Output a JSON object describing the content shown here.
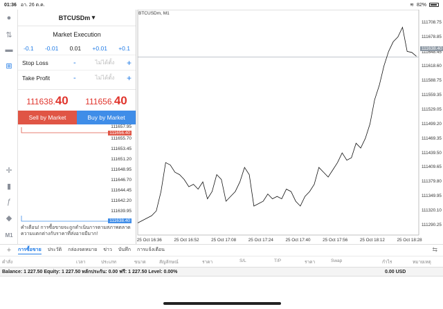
{
  "status": {
    "time": "01:36",
    "date": "อา. 26 ต.ค.",
    "battery": "82%"
  },
  "panel": {
    "symbol": "BTCUSDm",
    "execution": "Market Execution",
    "volume_steps": [
      "-0.1",
      "-0.01",
      "0.01",
      "+0.01",
      "+0.1"
    ],
    "stop_loss_label": "Stop Loss",
    "take_profit_label": "Take Profit",
    "not_set": "ไม่ได้ตั้ง",
    "minus": "-",
    "plus": "+",
    "bid_prefix": "111638.",
    "bid_suffix": "40",
    "ask_prefix": "111656.",
    "ask_suffix": "40",
    "sell_label": "Sell by Market",
    "buy_label": "Buy by Market",
    "depth_levels": [
      "111657.95",
      "111656.40",
      "111655.70",
      "111653.45",
      "111651.20",
      "111648.95",
      "111646.70",
      "111644.45",
      "111642.20",
      "111639.95",
      "111638.40"
    ],
    "warning": "คำเตือน! การซื้อขายจะถูกดำเนินการตามสภาพตลาด ความแตกต่างกับราคาที่ส่งอาจมีมาก!"
  },
  "chart_header": "BTCUSDm, M1",
  "chart_data": {
    "type": "line",
    "symbol": "BTCUSDm",
    "timeframe": "M1",
    "current_price": 111638.4,
    "y_ticks": [
      "111708.75",
      "111678.85",
      "111648.45",
      "111618.60",
      "111588.75",
      "111559.35",
      "111529.05",
      "111499.20",
      "111469.35",
      "111439.50",
      "111409.65",
      "111379.80",
      "111349.95",
      "111320.10",
      "111290.25"
    ],
    "y_ticks_numeric": [
      111708.75,
      111678.85,
      111648.45,
      111618.6,
      111588.75,
      111559.35,
      111529.05,
      111499.2,
      111469.35,
      111439.5,
      111409.65,
      111379.8,
      111349.95,
      111320.1,
      111290.25
    ],
    "x_ticks": [
      "25 Oct 16:36",
      "25 Oct 16:52",
      "25 Oct 17:08",
      "25 Oct 17:24",
      "25 Oct 17:40",
      "25 Oct 17:56",
      "25 Oct 18:12",
      "25 Oct 18:28"
    ],
    "x_tick_index": [
      5,
      21,
      37,
      53,
      69,
      85,
      101,
      117
    ],
    "ylim": [
      111270,
      111725
    ],
    "x": [
      0,
      2,
      4,
      6,
      8,
      10,
      12,
      14,
      16,
      18,
      20,
      22,
      24,
      26,
      28,
      30,
      32,
      34,
      36,
      38,
      40,
      42,
      44,
      46,
      48,
      50,
      52,
      54,
      56,
      58,
      60,
      62,
      64,
      66,
      68,
      70,
      72,
      74,
      76,
      78,
      80,
      82,
      84,
      86,
      88,
      90,
      92,
      94,
      96,
      98,
      100,
      102,
      104,
      106,
      108,
      110,
      112,
      114,
      116,
      118,
      120
    ],
    "values": [
      111295,
      111300,
      111305,
      111310,
      111320,
      111360,
      111420,
      111415,
      111400,
      111395,
      111385,
      111370,
      111375,
      111365,
      111380,
      111345,
      111360,
      111395,
      111385,
      111340,
      111350,
      111360,
      111380,
      111410,
      111395,
      111330,
      111335,
      111340,
      111355,
      111345,
      111350,
      111345,
      111365,
      111360,
      111340,
      111330,
      111350,
      111360,
      111375,
      111410,
      111400,
      111390,
      111405,
      111420,
      111440,
      111425,
      111430,
      111460,
      111450,
      111470,
      111500,
      111550,
      111580,
      111620,
      111650,
      111670,
      111680,
      111700,
      111650,
      111648,
      111640
    ]
  },
  "bottom": {
    "tabs": [
      "การซื้อขาย",
      "ประวัติ",
      "กล่องจดหมาย",
      "ข่าว",
      "บันทึก",
      "การแจ้งเตือน"
    ],
    "columns": [
      "คำสั่ง",
      "เวลา",
      "ประเภท",
      "ขนาด",
      "สัญลักษณ์",
      "ราคา",
      "S/L",
      "T/P",
      "ราคา",
      "Swap",
      "กำไร",
      "หมายเหตุ"
    ],
    "balance_line": "Balance: 1 227.50 Equity: 1 227.50 หลักประกัน: 0.00 ฟรี: 1 227.50 Level: 0.00%",
    "profit_value": "0.00  USD"
  },
  "colors": {
    "sell": "#e05545",
    "buy": "#3f8de8",
    "accent": "#1e7ae6",
    "price_red": "#e0342c",
    "current_tag": "#8d98a4"
  }
}
